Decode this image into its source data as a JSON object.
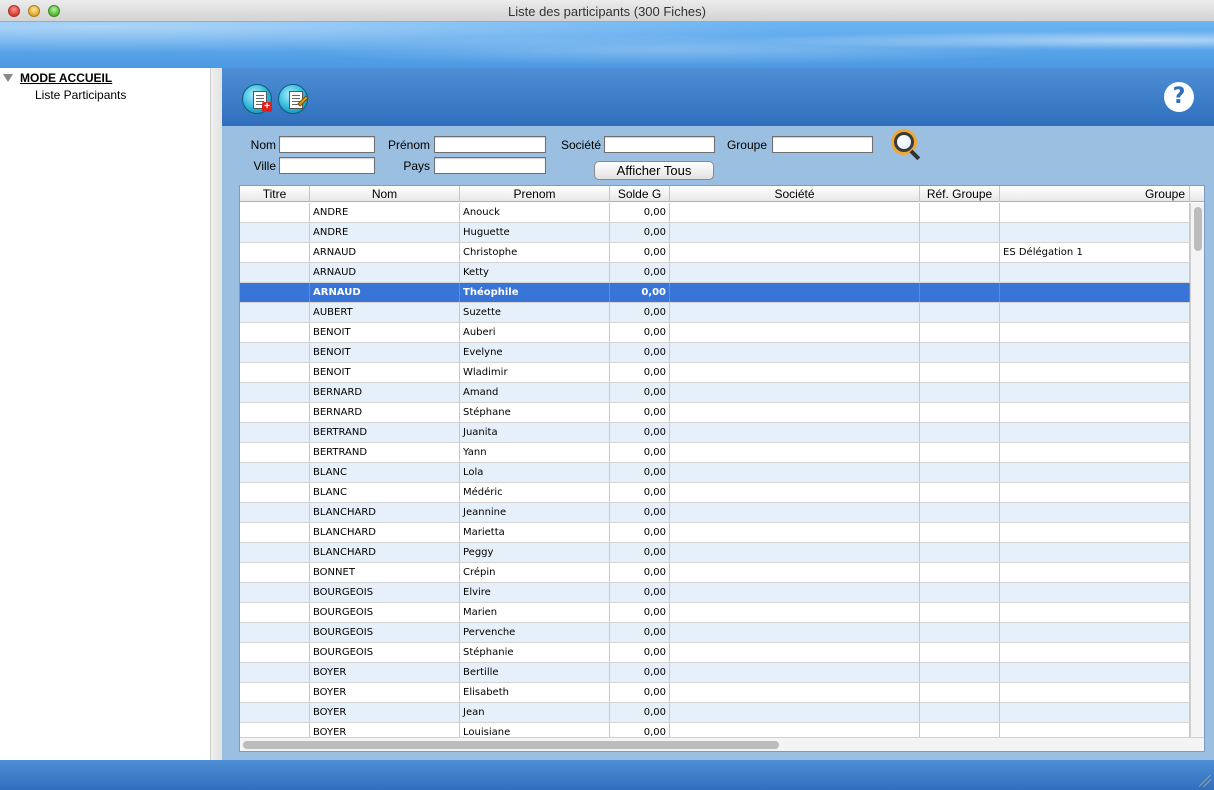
{
  "window": {
    "title": "Liste des participants (300 Fiches)"
  },
  "sidebar": {
    "section_label": "MODE ACCUEIL",
    "items": [
      {
        "label": "Liste Participants"
      }
    ]
  },
  "toolbar": {
    "help_label": "?"
  },
  "search": {
    "nom_label": "Nom",
    "prenom_label": "Prénom",
    "societe_label": "Société",
    "groupe_label": "Groupe",
    "ville_label": "Ville",
    "pays_label": "Pays",
    "nom_value": "",
    "prenom_value": "",
    "societe_value": "",
    "groupe_value": "",
    "ville_value": "",
    "pays_value": "",
    "show_all_label": "Afficher Tous"
  },
  "table": {
    "columns": [
      "Titre",
      "Nom",
      "Prenom",
      "Solde G",
      "Société",
      "Réf. Groupe",
      "Groupe"
    ],
    "selected_index": 4,
    "rows": [
      {
        "titre": "",
        "nom": "ANDRE",
        "prenom": "Anouck",
        "solde": "0,00",
        "societe": "",
        "ref_groupe": "",
        "groupe": ""
      },
      {
        "titre": "",
        "nom": "ANDRE",
        "prenom": "Huguette",
        "solde": "0,00",
        "societe": "",
        "ref_groupe": "",
        "groupe": ""
      },
      {
        "titre": "",
        "nom": "ARNAUD",
        "prenom": "Christophe",
        "solde": "0,00",
        "societe": "",
        "ref_groupe": "",
        "groupe": "ES Délégation 1"
      },
      {
        "titre": "",
        "nom": "ARNAUD",
        "prenom": "Ketty",
        "solde": "0,00",
        "societe": "",
        "ref_groupe": "",
        "groupe": ""
      },
      {
        "titre": "",
        "nom": "ARNAUD",
        "prenom": "Théophile",
        "solde": "0,00",
        "societe": "",
        "ref_groupe": "",
        "groupe": ""
      },
      {
        "titre": "",
        "nom": "AUBERT",
        "prenom": "Suzette",
        "solde": "0,00",
        "societe": "",
        "ref_groupe": "",
        "groupe": ""
      },
      {
        "titre": "",
        "nom": "BENOIT",
        "prenom": "Auberi",
        "solde": "0,00",
        "societe": "",
        "ref_groupe": "",
        "groupe": ""
      },
      {
        "titre": "",
        "nom": "BENOIT",
        "prenom": "Evelyne",
        "solde": "0,00",
        "societe": "",
        "ref_groupe": "",
        "groupe": ""
      },
      {
        "titre": "",
        "nom": "BENOIT",
        "prenom": "Wladimir",
        "solde": "0,00",
        "societe": "",
        "ref_groupe": "",
        "groupe": ""
      },
      {
        "titre": "",
        "nom": "BERNARD",
        "prenom": "Amand",
        "solde": "0,00",
        "societe": "",
        "ref_groupe": "",
        "groupe": ""
      },
      {
        "titre": "",
        "nom": "BERNARD",
        "prenom": "Stéphane",
        "solde": "0,00",
        "societe": "",
        "ref_groupe": "",
        "groupe": ""
      },
      {
        "titre": "",
        "nom": "BERTRAND",
        "prenom": "Juanita",
        "solde": "0,00",
        "societe": "",
        "ref_groupe": "",
        "groupe": ""
      },
      {
        "titre": "",
        "nom": "BERTRAND",
        "prenom": "Yann",
        "solde": "0,00",
        "societe": "",
        "ref_groupe": "",
        "groupe": ""
      },
      {
        "titre": "",
        "nom": "BLANC",
        "prenom": "Lola",
        "solde": "0,00",
        "societe": "",
        "ref_groupe": "",
        "groupe": ""
      },
      {
        "titre": "",
        "nom": "BLANC",
        "prenom": "Médéric",
        "solde": "0,00",
        "societe": "",
        "ref_groupe": "",
        "groupe": ""
      },
      {
        "titre": "",
        "nom": "BLANCHARD",
        "prenom": "Jeannine",
        "solde": "0,00",
        "societe": "",
        "ref_groupe": "",
        "groupe": ""
      },
      {
        "titre": "",
        "nom": "BLANCHARD",
        "prenom": "Marietta",
        "solde": "0,00",
        "societe": "",
        "ref_groupe": "",
        "groupe": ""
      },
      {
        "titre": "",
        "nom": "BLANCHARD",
        "prenom": "Peggy",
        "solde": "0,00",
        "societe": "",
        "ref_groupe": "",
        "groupe": ""
      },
      {
        "titre": "",
        "nom": "BONNET",
        "prenom": "Crépin",
        "solde": "0,00",
        "societe": "",
        "ref_groupe": "",
        "groupe": ""
      },
      {
        "titre": "",
        "nom": "BOURGEOIS",
        "prenom": "Elvire",
        "solde": "0,00",
        "societe": "",
        "ref_groupe": "",
        "groupe": ""
      },
      {
        "titre": "",
        "nom": "BOURGEOIS",
        "prenom": "Marien",
        "solde": "0,00",
        "societe": "",
        "ref_groupe": "",
        "groupe": ""
      },
      {
        "titre": "",
        "nom": "BOURGEOIS",
        "prenom": "Pervenche",
        "solde": "0,00",
        "societe": "",
        "ref_groupe": "",
        "groupe": ""
      },
      {
        "titre": "",
        "nom": "BOURGEOIS",
        "prenom": "Stéphanie",
        "solde": "0,00",
        "societe": "",
        "ref_groupe": "",
        "groupe": ""
      },
      {
        "titre": "",
        "nom": "BOYER",
        "prenom": "Bertille",
        "solde": "0,00",
        "societe": "",
        "ref_groupe": "",
        "groupe": ""
      },
      {
        "titre": "",
        "nom": "BOYER",
        "prenom": "Elisabeth",
        "solde": "0,00",
        "societe": "",
        "ref_groupe": "",
        "groupe": ""
      },
      {
        "titre": "",
        "nom": "BOYER",
        "prenom": "Jean",
        "solde": "0,00",
        "societe": "",
        "ref_groupe": "",
        "groupe": ""
      },
      {
        "titre": "",
        "nom": "BOYER",
        "prenom": "Louisiane",
        "solde": "0,00",
        "societe": "",
        "ref_groupe": "",
        "groupe": ""
      }
    ]
  },
  "colors": {
    "selection": "#3875d7",
    "row_alt": "#e6f0fb",
    "banner": "#4c99e3",
    "toolbar": "#2f6fbd"
  },
  "icons": {
    "new_record": "add-participant-icon",
    "edit_record": "edit-participant-icon",
    "search": "search-icon",
    "help": "help-icon"
  }
}
